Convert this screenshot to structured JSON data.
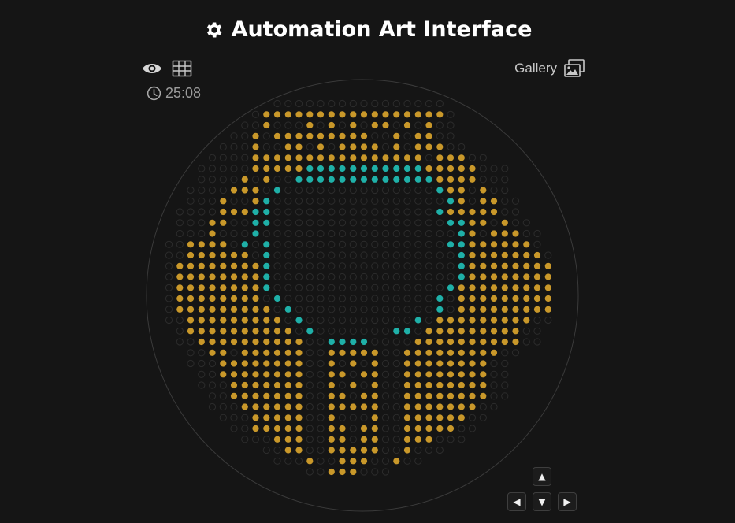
{
  "app": {
    "title": "Automation Art Interface",
    "title_icon": "gear-icon"
  },
  "toolbar": {
    "eye_icon": "eye-icon",
    "grid_icon": "grid-icon",
    "timer_icon": "clock-icon",
    "timer_text": "25:08",
    "gallery_label": "Gallery",
    "gallery_icon": "gallery-icon"
  },
  "dpad": {
    "up": "▲",
    "down": "▼",
    "left": "◀",
    "right": "▶"
  },
  "colors": {
    "background": "#151515",
    "gold": "#c9982a",
    "teal": "#1fb0a8",
    "empty_outline": "#2c2c2c",
    "boundary": "#3a3a3a"
  },
  "canvas": {
    "cols": 40,
    "rows": 40,
    "pattern": [
      "                                        ",
      "                                        ",
      "           ..........+.......           ",
      "          .GGGGGGGGGGGGGGGGG.           ",
      "         ..G...G.G.G.GG.G.G..           ",
      "        ..G.GGGGGGGGG..G.GG..           ",
      "       ...G..GG.G.GGGG.G.GGG..          ",
      "      ....GGGGGGGGGGGGGGGG.GGG..        ",
      "     .....GGGGGTTTTTTTTTTTGGGGG...      ",
      "     ....G.G..TTTTTTTTTTTTTGGGG...      ",
      "    ....GGG.T..............TGG.G..      ",
      "    ...G..GT................TG.GG..     ",
      "   ....GGGTT...............TGGGGG..    ",
      "   ...GG..TT................TTGG.G..   ",
      "   ...G...T..................TG.GGG..  ",
      "  ..GGGG.T.T................TTGGGGGG.  ",
      "  ..GGGGGG.T.................TGGGGGGG. ",
      "  .GGGGGGGGT.................TGGGGGGGG ",
      "  .GGGGGGGGT.................TGGGGGGGG ",
      "  .GGGGGGGGT................TGGGGGGGGG ",
      "  .GGGGGGGG.T..............T.GGGGGGGGG ",
      "  .GGGGGGGGG.T.............T.GGGGGGGGG ",
      "  ..GGGGGGGGG.T..........T.GGGGGGGGG.. ",
      "   .GGGGGGGGGG.T.......TT.GGGGGGGGG..  ",
      "   ..GGGGGGGGGG..TTTT....GGGGGGGGGG..  ",
      "    ..GG.GGGGGG..GGGGG..GGGGGGGGG..    ",
      "    ...GGGGGGGG..G.G.G..GGGGGGGG..     ",
      "     ..GGGGGGGG..GG.GG..GGGGGGGG..     ",
      "     ...GGGGGGG..G.G.G..GGGGGGGG..     ",
      "      ..GGGGGGG..GG.GG..GGGGGGGG..     ",
      "      ...GGGGGG..GGGGG..GGGGGGG..      ",
      "       ...GGGGG..G...G..GGGGGG..       ",
      "        ..GGGGG..GG.GG..GGGGG..        ",
      "         ...GGG..GG.GG..GGG...         ",
      "           ..GG..GGGGG..G...           ",
      "            ...G..GGG..G..             ",
      "               ..GGG...                ",
      "                                        ",
      "                                        ",
      "                                        "
    ]
  }
}
